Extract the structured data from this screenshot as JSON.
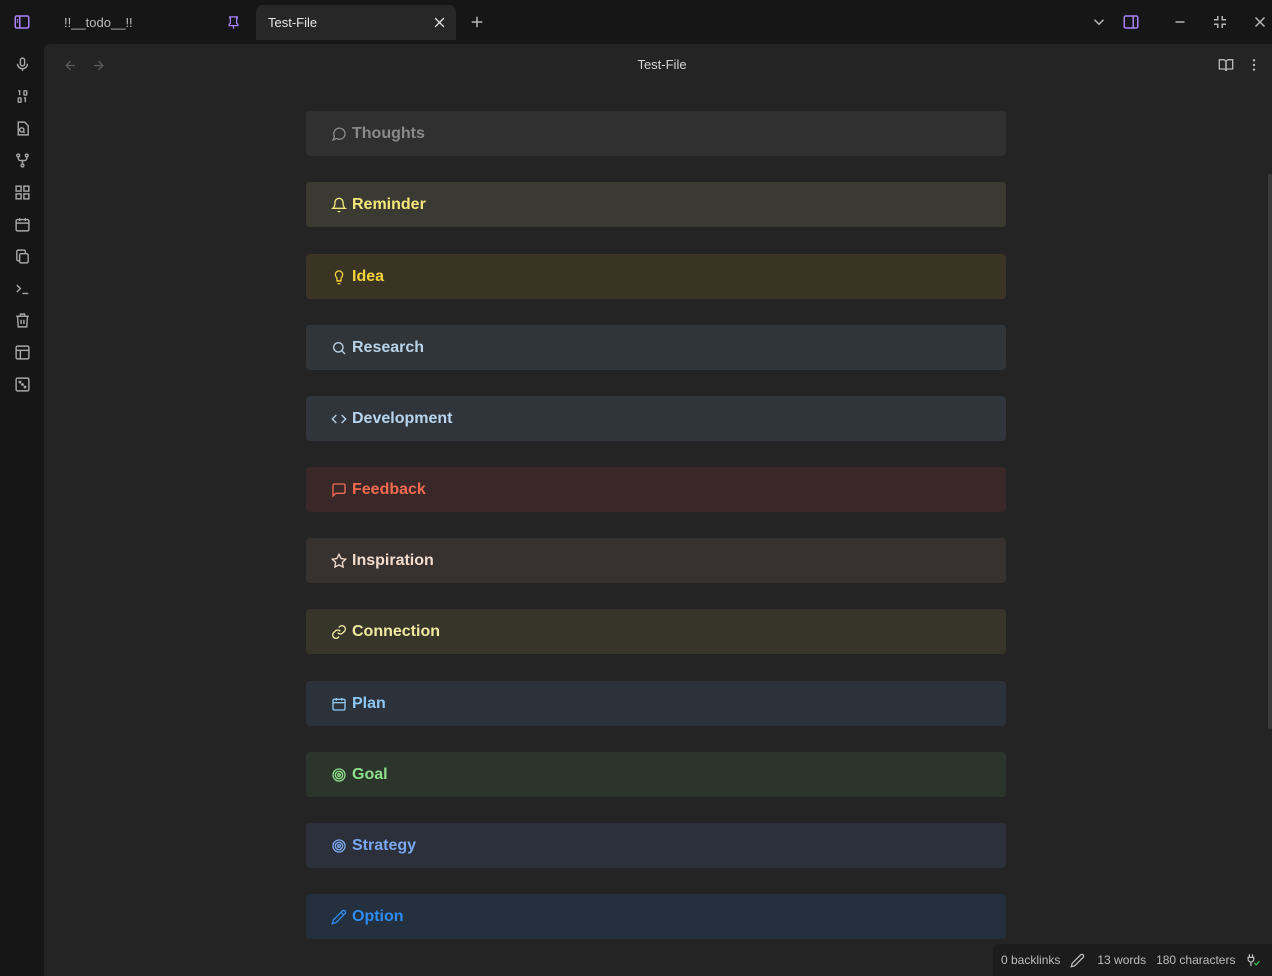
{
  "tabs": [
    {
      "label": "!!__todo__!!"
    },
    {
      "label": "Test-File"
    }
  ],
  "view": {
    "title": "Test-File"
  },
  "callouts": [
    {
      "title": "Thoughts",
      "icon": "message-circle-icon",
      "color": "#8a8a8a",
      "bg": "#303030"
    },
    {
      "title": "Reminder",
      "icon": "bell-icon",
      "color": "#f4e87a",
      "bg": "#3a3a32"
    },
    {
      "title": "Idea",
      "icon": "lightbulb-icon",
      "color": "#f2d33a",
      "bg": "#3a3424"
    },
    {
      "title": "Research",
      "icon": "search-icon",
      "color": "#b9d2e6",
      "bg": "#30353a"
    },
    {
      "title": "Development",
      "icon": "code-icon",
      "color": "#b9d5ee",
      "bg": "#30353b"
    },
    {
      "title": "Feedback",
      "icon": "message-square-icon",
      "color": "#f06a51",
      "bg": "#3a2828"
    },
    {
      "title": "Inspiration",
      "icon": "star-icon",
      "color": "#f3dccb",
      "bg": "#37312f"
    },
    {
      "title": "Connection",
      "icon": "link-icon",
      "color": "#f3e9a1",
      "bg": "#37342a"
    },
    {
      "title": "Plan",
      "icon": "calendar-icon",
      "color": "#8ec8f2",
      "bg": "#2b323a"
    },
    {
      "title": "Goal",
      "icon": "target-icon",
      "color": "#8ee08c",
      "bg": "#2c352c"
    },
    {
      "title": "Strategy",
      "icon": "target-icon",
      "color": "#7aa7f0",
      "bg": "#2c303a"
    },
    {
      "title": "Option",
      "icon": "pencil-icon",
      "color": "#2f8bf2",
      "bg": "#24303d"
    }
  ],
  "statusbar": {
    "backlinks": "0 backlinks",
    "words": "13 words",
    "characters": "180 characters"
  },
  "colors": {
    "accent": "#a882ff"
  }
}
